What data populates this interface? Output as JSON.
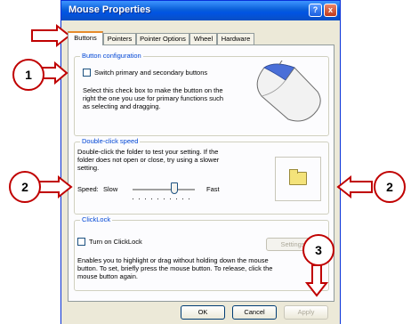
{
  "window": {
    "title": "Mouse Properties",
    "help_glyph": "?",
    "close_glyph": "x"
  },
  "tabs": [
    "Buttons",
    "Pointers",
    "Pointer Options",
    "Wheel",
    "Hardware"
  ],
  "button_config": {
    "title": "Button configuration",
    "checkbox_label": "Switch primary and secondary buttons",
    "description": [
      "Select this check box to make the button on the",
      "right the one you use for primary functions such",
      "as selecting and dragging."
    ]
  },
  "double_click": {
    "title": "Double-click speed",
    "description": [
      "Double-click the folder to test your setting. If the",
      "folder does not open or close, try using a slower",
      "setting."
    ],
    "speed_label": "Speed:",
    "slow_label": "Slow",
    "fast_label": "Fast"
  },
  "clicklock": {
    "title": "ClickLock",
    "checkbox_label": "Turn on ClickLock",
    "settings_label": "Settings",
    "description": [
      "Enables you to highlight or drag without holding down the mouse",
      "button. To set, briefly press the mouse button. To release, click the",
      "mouse button again."
    ]
  },
  "buttons": {
    "ok": "OK",
    "cancel": "Cancel",
    "apply": "Apply"
  },
  "callouts": {
    "c1": "1",
    "c2_left": "2",
    "c2_right": "2",
    "c3": "3"
  },
  "colors": {
    "callout": "#c00000",
    "titlebar": "#0054e3",
    "group_title": "#0046d5"
  }
}
